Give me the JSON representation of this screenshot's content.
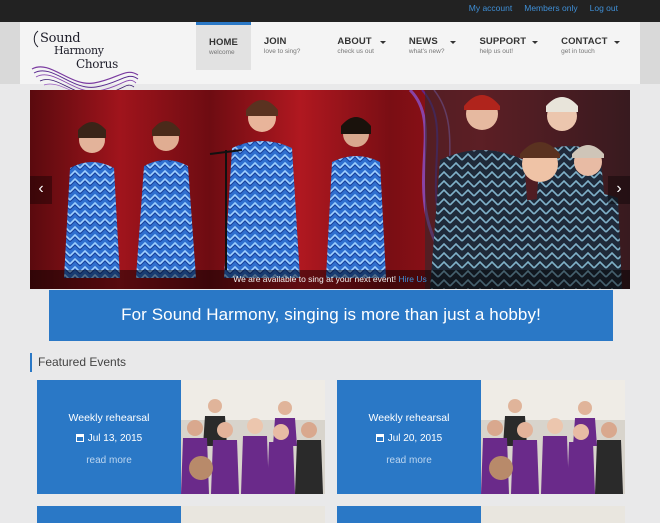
{
  "topbar": {
    "links": [
      "My account",
      "Members only",
      "Log out"
    ]
  },
  "logo": {
    "line1": "Sound",
    "line2": "Harmony",
    "line3": "Chorus"
  },
  "nav": {
    "items": [
      {
        "title": "HOME",
        "sub": "welcome"
      },
      {
        "title": "JOIN",
        "sub": "love to sing?"
      },
      {
        "title": "ABOUT",
        "sub": "check us out"
      },
      {
        "title": "NEWS",
        "sub": "what's new?"
      },
      {
        "title": "SUPPORT",
        "sub": "help us out!"
      },
      {
        "title": "CONTACT",
        "sub": "get in touch"
      }
    ]
  },
  "hero": {
    "caption": "We are available to sing at your next event!",
    "caption_link": "Hire Us"
  },
  "tagline": "For Sound Harmony, singing is more than just a hobby!",
  "featured": {
    "heading": "Featured Events",
    "events": [
      {
        "title": "Weekly rehearsal",
        "date": "Jul 13, 2015",
        "more": "read more"
      },
      {
        "title": "Weekly rehearsal",
        "date": "Jul 20, 2015",
        "more": "read more"
      }
    ]
  },
  "colors": {
    "accent": "#2a78c6",
    "topbar": "#222222",
    "link": "#3f8fd6"
  }
}
